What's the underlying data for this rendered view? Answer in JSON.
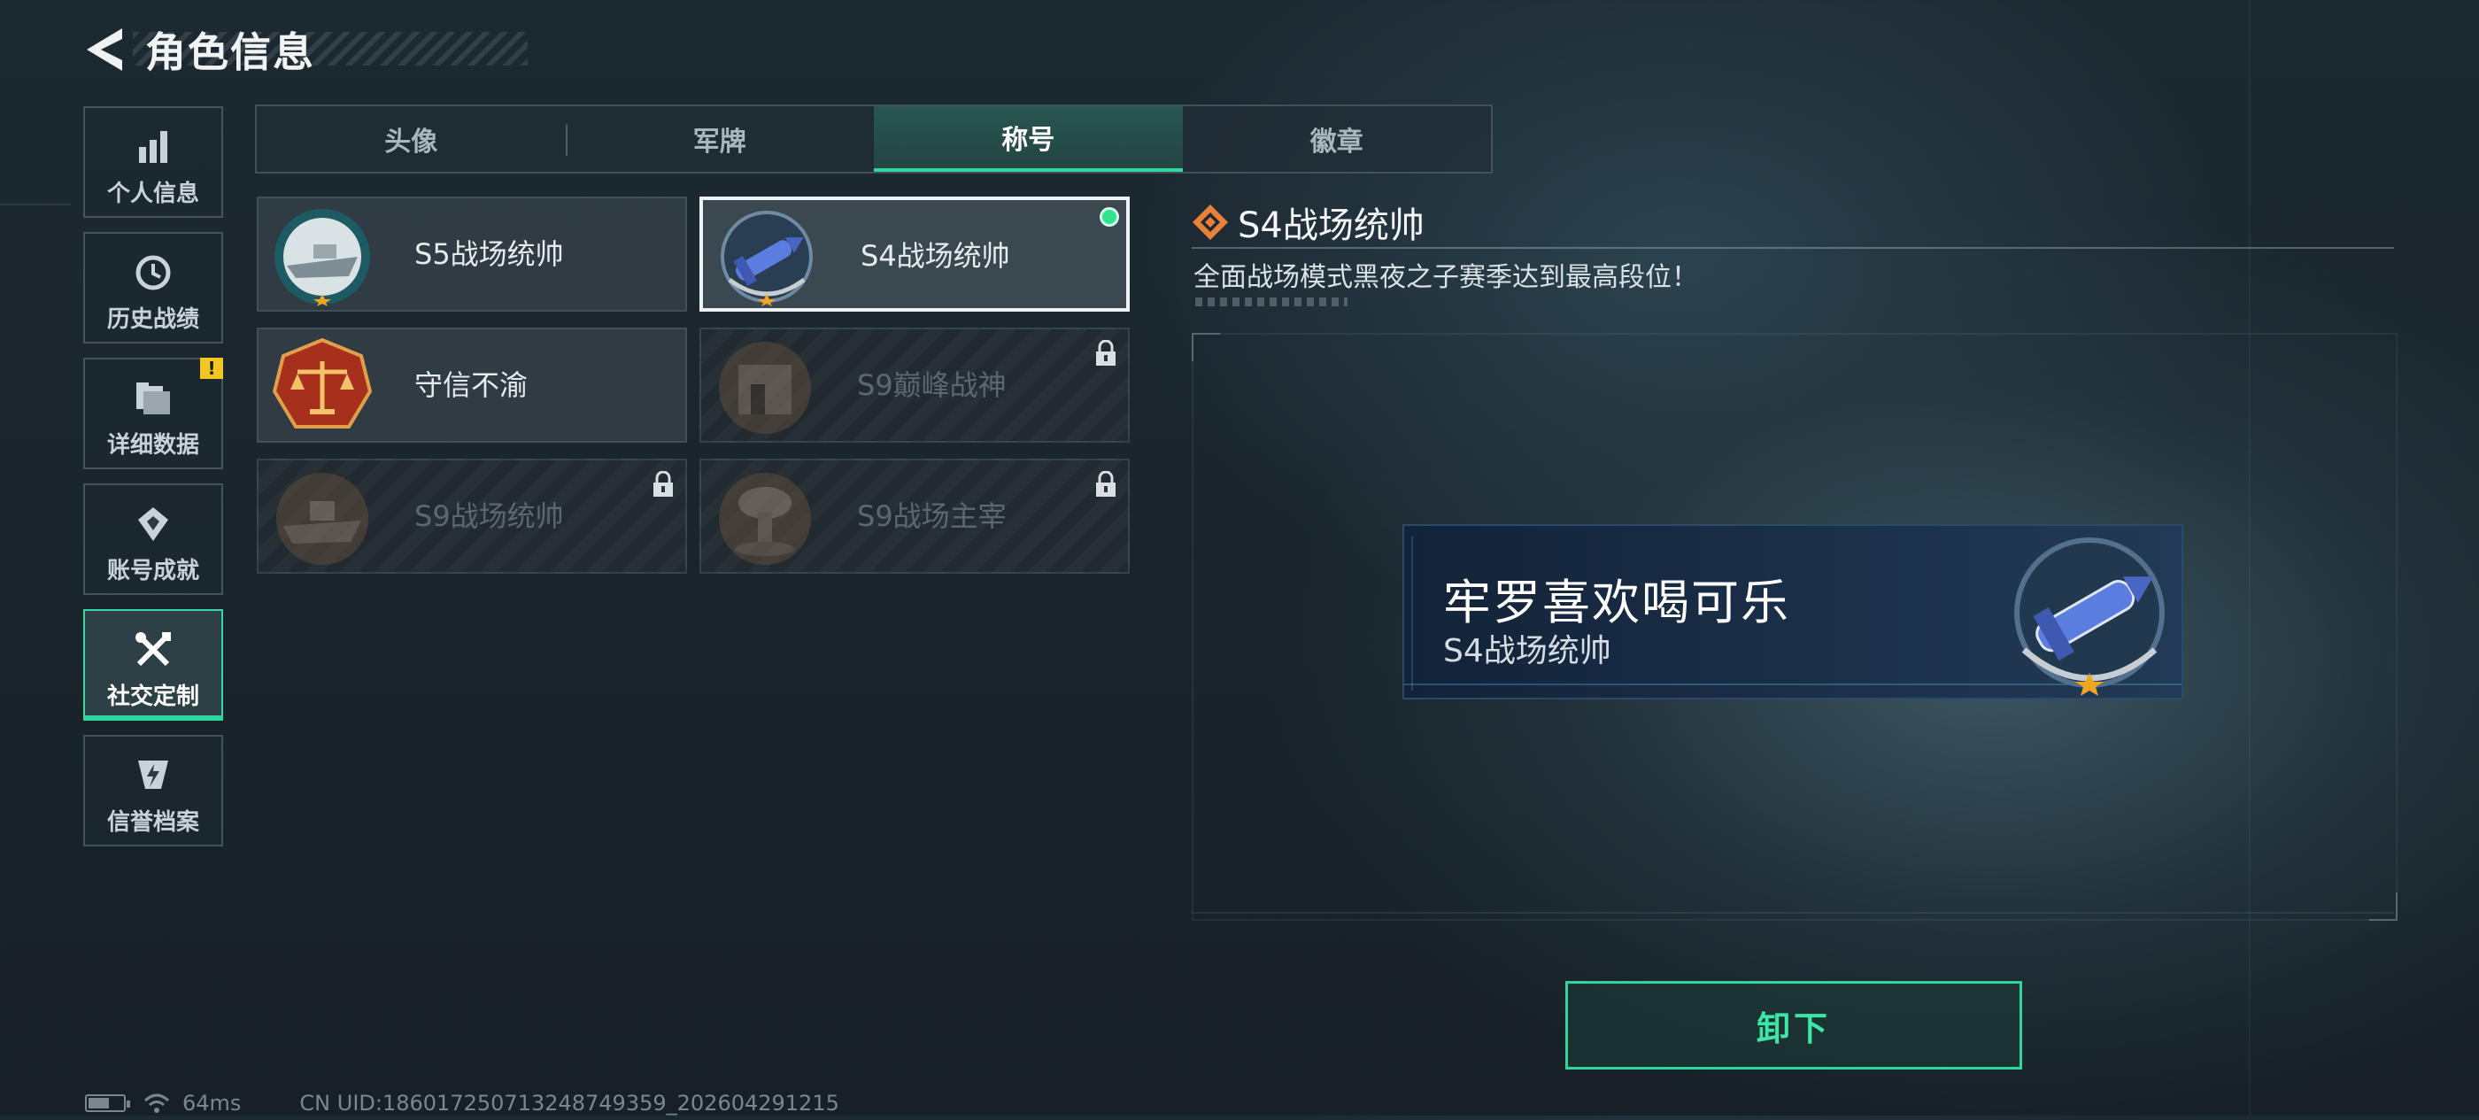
{
  "header": {
    "title": "角色信息",
    "back_icon": "back-arrow-icon"
  },
  "sidebar": {
    "items": [
      {
        "label": "个人信息",
        "icon": "bar-chart-icon",
        "active": false
      },
      {
        "label": "历史战绩",
        "icon": "history-icon",
        "active": false
      },
      {
        "label": "详细数据",
        "icon": "folder-data-icon",
        "active": false,
        "badge": "!"
      },
      {
        "label": "账号成就",
        "icon": "achievement-icon",
        "active": false
      },
      {
        "label": "社交定制",
        "icon": "tools-icon",
        "active": true
      },
      {
        "label": "信誉档案",
        "icon": "reputation-shield-icon",
        "active": false
      }
    ]
  },
  "tabs": [
    {
      "label": "头像",
      "active": false
    },
    {
      "label": "军牌",
      "active": false
    },
    {
      "label": "称号",
      "active": true
    },
    {
      "label": "徽章",
      "active": false
    }
  ],
  "titles": [
    {
      "name": "S5战场统帅",
      "emblem": "boat-emblem-icon",
      "locked": false,
      "selected": false,
      "equipped": false
    },
    {
      "name": "S4战场统帅",
      "emblem": "missile-emblem-icon",
      "locked": false,
      "selected": true,
      "equipped": true
    },
    {
      "name": "守信不渝",
      "emblem": "scales-emblem-icon",
      "locked": false,
      "selected": false,
      "equipped": false
    },
    {
      "name": "S9巅峰战神",
      "emblem": "ruins-emblem-icon",
      "locked": true,
      "selected": false,
      "equipped": false
    },
    {
      "name": "S9战场统帅",
      "emblem": "warship-emblem-icon",
      "locked": true,
      "selected": false,
      "equipped": false
    },
    {
      "name": "S9战场主宰",
      "emblem": "mushroom-cloud-emblem-icon",
      "locked": true,
      "selected": false,
      "equipped": false
    }
  ],
  "detail": {
    "title": "S4战场统帅",
    "description": "全面战场模式黑夜之子赛季达到最高段位！"
  },
  "nameplate": {
    "player_name": "牢罗喜欢喝可乐",
    "title": "S4战场统帅",
    "emblem": "missile-emblem-icon"
  },
  "action": {
    "unequip_label": "卸下"
  },
  "status": {
    "ping": "64ms",
    "uid": "CN UID:1860172507132487493​59_202604291215"
  },
  "colors": {
    "accent": "#32d69b",
    "warning": "#f3c623",
    "selected_border": "#eef2f3",
    "orange_diamond": "#e8803a"
  }
}
